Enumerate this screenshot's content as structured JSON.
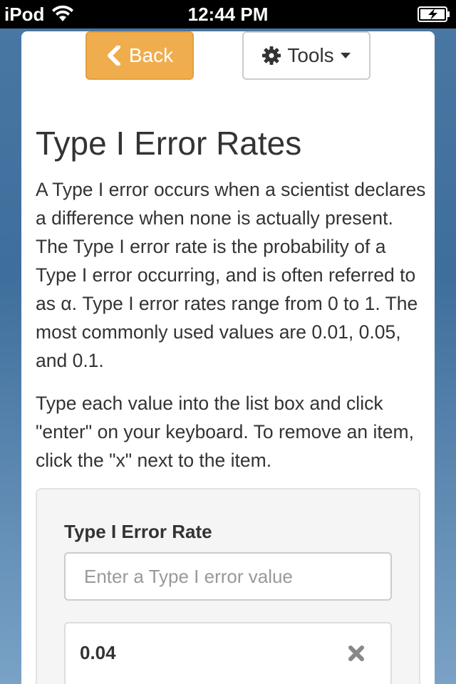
{
  "status_bar": {
    "carrier": "iPod",
    "time": "12:44 PM",
    "wifi_icon": "wifi-icon",
    "battery_icon": "battery-charging-icon"
  },
  "toolbar": {
    "back_label": "Back",
    "back_icon": "chevron-left-icon",
    "tools_label": "Tools",
    "tools_icon": "gear-icon",
    "tools_caret_icon": "caret-down-icon",
    "back_color": "#f0ad4e"
  },
  "page": {
    "title": "Type I Error Rates",
    "paragraph_1": "A Type I error occurs when a scientist declares a difference when none is actually present. The Type I error rate is the probability of a Type I error occurring, and is often referred to as α. Type I error rates range from 0 to 1. The most commonly used values are 0.01, 0.05, and 0.1.",
    "paragraph_2": "Type each value into the list box and click \"enter\" on your keyboard. To remove an item, click the \"x\" next to the item."
  },
  "form": {
    "label": "Type I Error Rate",
    "input_placeholder": "Enter a Type I error value",
    "input_value": "",
    "items": [
      {
        "value": "0.04",
        "remove_icon": "close-icon"
      }
    ]
  }
}
